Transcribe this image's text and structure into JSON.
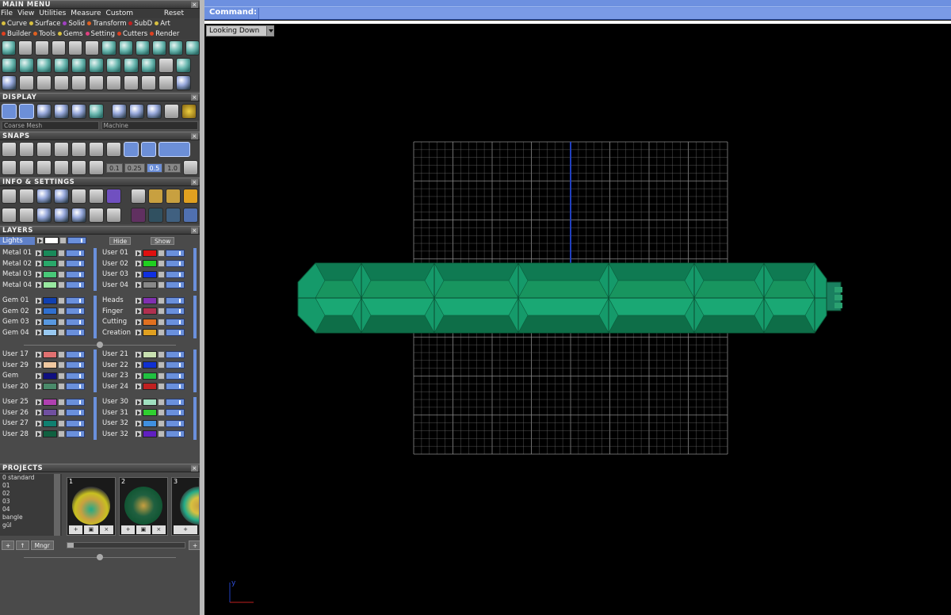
{
  "main_menu": {
    "title": "MAIN MENU",
    "menus": [
      "File",
      "View",
      "Utilities",
      "Measure",
      "Custom"
    ],
    "reset": "Reset",
    "row1": [
      {
        "label": "Curve",
        "color": "#d8c040"
      },
      {
        "label": "Surface",
        "color": "#d8c040"
      },
      {
        "label": "Solid",
        "color": "#a040c0"
      },
      {
        "label": "Transform",
        "color": "#e06020"
      },
      {
        "label": "SubD",
        "color": "#c02020"
      },
      {
        "label": "Art",
        "color": "#d8c040"
      }
    ],
    "row2": [
      {
        "label": "Builder",
        "color": "#e04020"
      },
      {
        "label": "Tools",
        "color": "#e06020"
      },
      {
        "label": "Gems",
        "color": "#d8c040"
      },
      {
        "label": "Setting",
        "color": "#e04080"
      },
      {
        "label": "Cutters",
        "color": "#e04020"
      },
      {
        "label": "Render",
        "color": "#e04020"
      }
    ]
  },
  "display": {
    "title": "DISPLAY",
    "mesh_select": "Coarse Mesh",
    "material_select": "Machine"
  },
  "snaps": {
    "title": "SNAPS",
    "values": [
      "0.1",
      "0.25",
      "0.5",
      "1.0"
    ]
  },
  "info": {
    "title": "INFO & SETTINGS"
  },
  "layers": {
    "title": "LAYERS",
    "lights_label": "Lights",
    "hide_label": "Hide",
    "show_label": "Show",
    "group1_left": [
      {
        "name": "Metal 01",
        "color": "#1a8a5a"
      },
      {
        "name": "Metal 02",
        "color": "#2aa86a"
      },
      {
        "name": "Metal 03",
        "color": "#48c878"
      },
      {
        "name": "Metal 04",
        "color": "#98e8a0"
      }
    ],
    "group1_right": [
      {
        "name": "User 01",
        "color": "#e01010"
      },
      {
        "name": "User 02",
        "color": "#20d020"
      },
      {
        "name": "User 03",
        "color": "#1030e0"
      },
      {
        "name": "User 04",
        "color": "#888888"
      }
    ],
    "group2_left": [
      {
        "name": "Gem 01",
        "color": "#1040b0"
      },
      {
        "name": "Gem 02",
        "color": "#3070d0"
      },
      {
        "name": "Gem 03",
        "color": "#5898e0"
      },
      {
        "name": "Gem 04",
        "color": "#98c8f0"
      }
    ],
    "group2_right": [
      {
        "name": "Heads",
        "color": "#8030b0"
      },
      {
        "name": "Finger",
        "color": "#b03050"
      },
      {
        "name": "Cutting",
        "color": "#e07020"
      },
      {
        "name": "Creation",
        "color": "#e0a020"
      }
    ],
    "group3_left": [
      {
        "name": "User 17",
        "color": "#e07070"
      },
      {
        "name": "User 29",
        "color": "#f0c8a0"
      },
      {
        "name": "Gem",
        "color": "#101080"
      },
      {
        "name": "User 20",
        "color": "#4a8a6a"
      }
    ],
    "group3_right": [
      {
        "name": "User 21",
        "color": "#c8e0b0"
      },
      {
        "name": "User 22",
        "color": "#1030d0"
      },
      {
        "name": "User 23",
        "color": "#20c040"
      },
      {
        "name": "User 24",
        "color": "#c02020"
      }
    ],
    "group4_left": [
      {
        "name": "User 25",
        "color": "#b040b0"
      },
      {
        "name": "User 26",
        "color": "#7050a0"
      },
      {
        "name": "User 27",
        "color": "#108070"
      },
      {
        "name": "User 28",
        "color": "#106040"
      }
    ],
    "group4_right": [
      {
        "name": "User 30",
        "color": "#a0e0c0"
      },
      {
        "name": "User 31",
        "color": "#30d030"
      },
      {
        "name": "User 32",
        "color": "#4090e0"
      },
      {
        "name": "User 32",
        "color": "#6020c0"
      }
    ]
  },
  "projects": {
    "title": "PROJECTS",
    "list": [
      "0 standard",
      "01",
      "02",
      "03",
      "04",
      "bangle",
      "gül"
    ],
    "thumbs": [
      "1",
      "2",
      "3"
    ],
    "manager_button": "Mngr"
  },
  "viewport": {
    "command_label": "Command:",
    "view_name": "Looking Down",
    "axis_y": "y",
    "model_color": "#159a6a",
    "grid_color": "#6a6a6a"
  }
}
